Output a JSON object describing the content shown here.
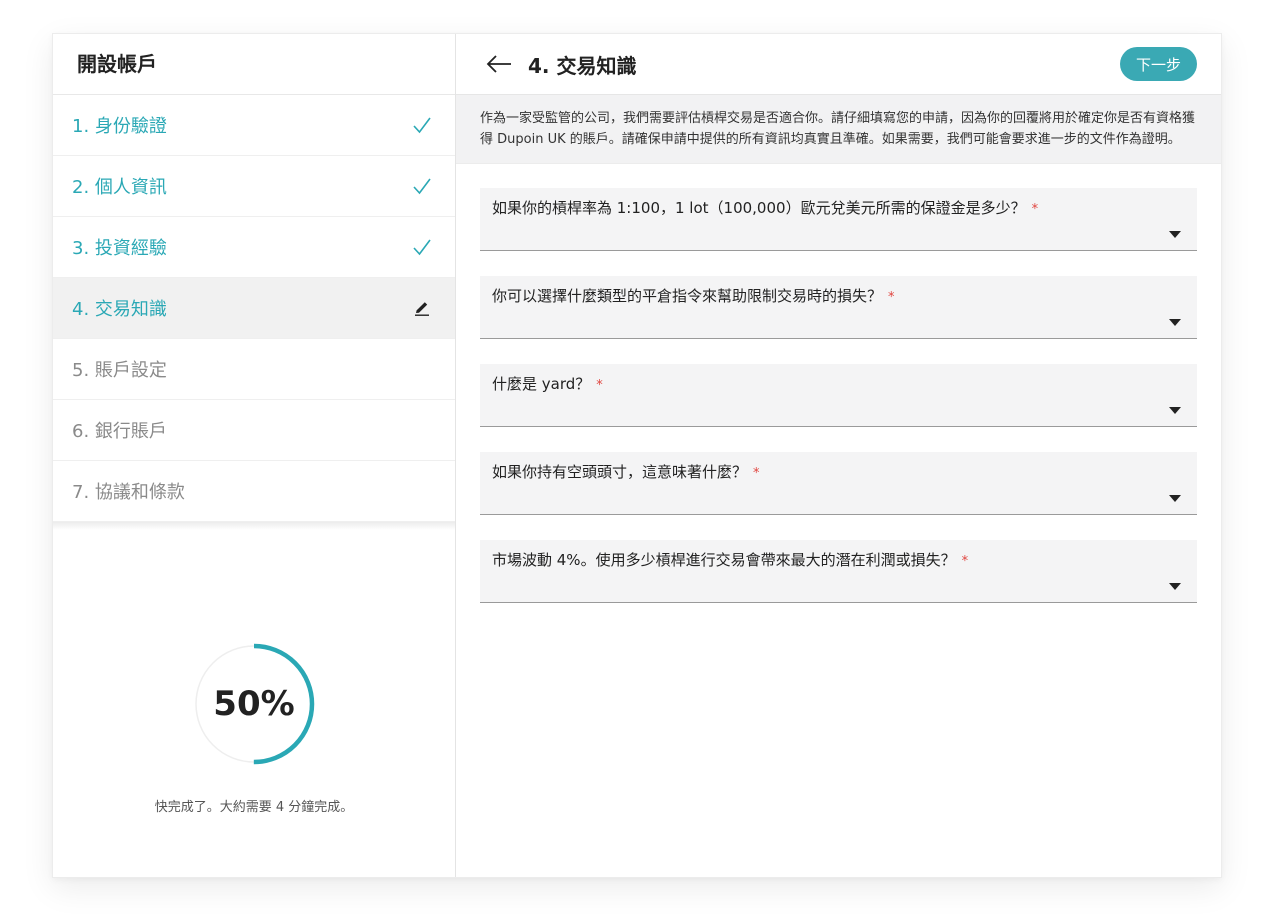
{
  "sidebar": {
    "title": "開設帳戶",
    "steps": [
      {
        "label": "1. 身份驗證",
        "state": "done",
        "icon": "check-icon"
      },
      {
        "label": "2. 個人資訊",
        "state": "done",
        "icon": "check-icon"
      },
      {
        "label": "3. 投資經驗",
        "state": "done",
        "icon": "check-icon"
      },
      {
        "label": "4. 交易知識",
        "state": "current",
        "icon": "pencil-icon"
      },
      {
        "label": "5. 賬戶設定",
        "state": "todo"
      },
      {
        "label": "6. 銀行賬戶",
        "state": "todo"
      },
      {
        "label": "7. 協議和條款",
        "state": "todo"
      }
    ],
    "progress": {
      "value_text": "50%",
      "fraction": 0.5,
      "note": "快完成了。大約需要 4 分鐘完成。"
    }
  },
  "main": {
    "title": "4. 交易知識",
    "next_label": "下一步",
    "notice": "作為一家受監管的公司，我們需要評估槓桿交易是否適合你。請仔細填寫您的申請，因為你的回覆將用於確定你是否有資格獲得 Dupoin UK 的賬戶。請確保申請中提供的所有資訊均真實且準確。如果需要，我們可能會要求進一步的文件作為證明。",
    "questions": [
      {
        "label": "如果你的槓桿率為 1:100，1 lot（100,000）歐元兌美元所需的保證金是多少？",
        "required": "*"
      },
      {
        "label": "你可以選擇什麼類型的平倉指令來幫助限制交易時的損失？",
        "required": "*"
      },
      {
        "label": "什麼是 yard？",
        "required": "*"
      },
      {
        "label": "如果你持有空頭頭寸，這意味著什麼？",
        "required": "*"
      },
      {
        "label": "市場波動 4%。使用多少槓桿進行交易會帶來最大的潛在利潤或損失？",
        "required": "*"
      }
    ]
  },
  "colors": {
    "accent": "#2aa8b5",
    "button": "#3aa9b4",
    "required": "#e0443e",
    "muted": "#8a8a8a"
  }
}
